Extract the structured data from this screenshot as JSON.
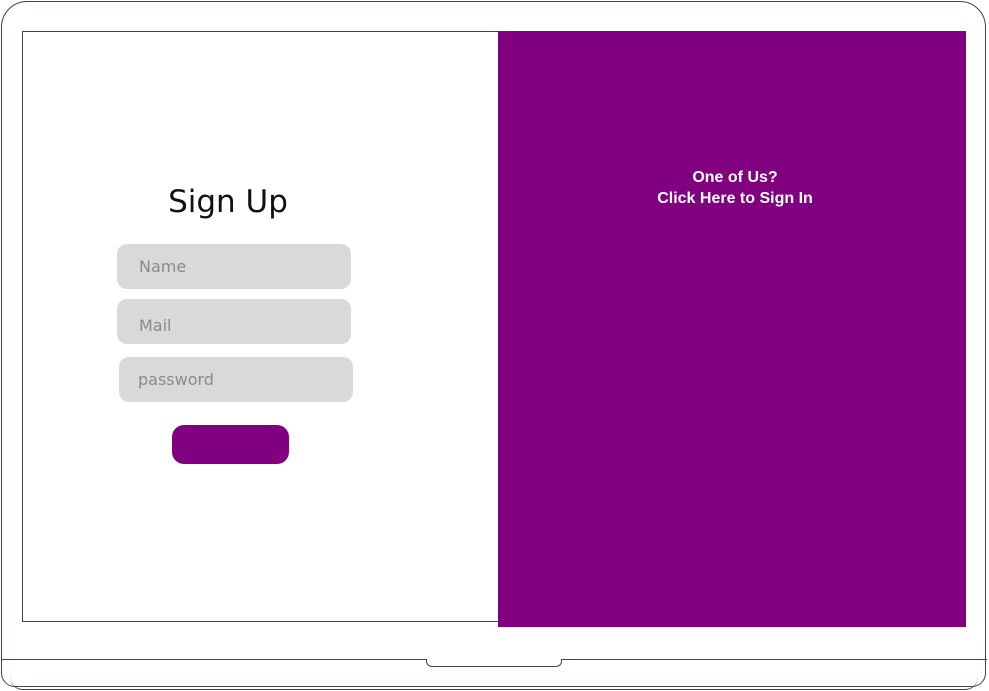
{
  "signup": {
    "title": "Sign Up",
    "name_placeholder": "Name",
    "mail_placeholder": "Mail",
    "password_placeholder": "password",
    "submit_label": ""
  },
  "signin": {
    "line1": "One of Us?",
    "line2": "Click Here to Sign In"
  },
  "colors": {
    "accent": "#800080",
    "field_bg": "#d9d9d9",
    "frame": "#3d4650"
  }
}
